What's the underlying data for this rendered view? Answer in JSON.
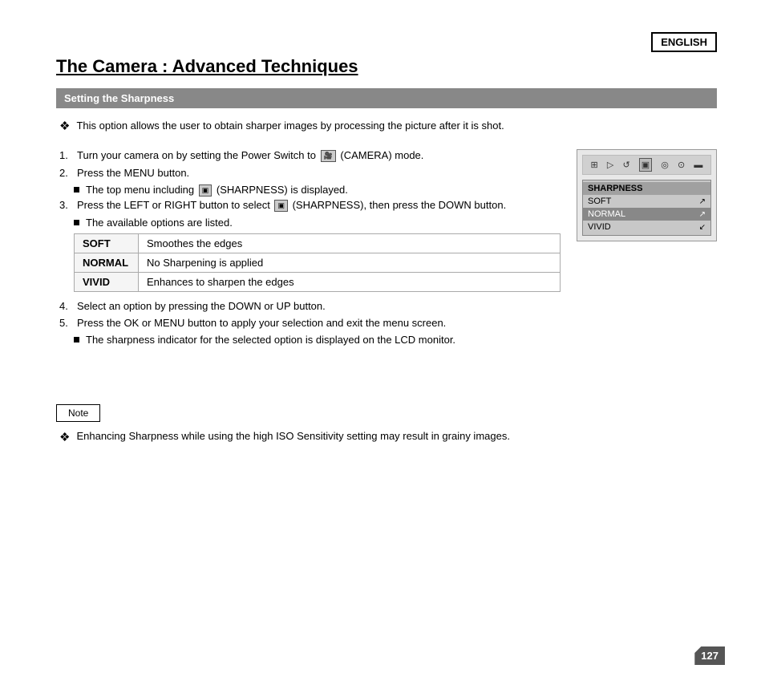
{
  "page": {
    "badge": "ENGLISH",
    "title": "The Camera : Advanced Techniques",
    "section_title": "Setting the Sharpness",
    "intro": "This option allows the user to obtain sharper images by processing the picture after it is shot.",
    "steps": [
      {
        "num": "1.",
        "text": "Turn your camera on by setting the Power Switch to  (CAMERA) mode."
      },
      {
        "num": "2.",
        "text": "Press the MENU button."
      },
      {
        "num": "2sub",
        "text": "The top menu including  (SHARPNESS) is displayed."
      },
      {
        "num": "3.",
        "text": "Press the LEFT or RIGHT button to select  (SHARPNESS), then press the DOWN button."
      },
      {
        "num": "3sub",
        "text": "The available options are listed."
      }
    ],
    "options_table": [
      {
        "key": "SOFT",
        "value": "Smoothes the edges"
      },
      {
        "key": "NORMAL",
        "value": "No Sharpening is applied"
      },
      {
        "key": "VIVID",
        "value": "Enhances to sharpen the edges"
      }
    ],
    "steps_after": [
      {
        "num": "4.",
        "text": "Select an option by pressing the DOWN or UP button."
      },
      {
        "num": "5.",
        "text": "Press the OK or MENU button to apply your selection and exit the menu screen."
      },
      {
        "num": "5sub",
        "text": "The sharpness indicator for the selected option is displayed on the LCD monitor."
      }
    ],
    "note_label": "Note",
    "note_text": "Enhancing Sharpness while using the high ISO Sensitivity setting may result in grainy images.",
    "page_number": "127",
    "camera_ui": {
      "menu_title": "SHARPNESS",
      "menu_items": [
        {
          "label": "SOFT",
          "icon": "↗",
          "highlighted": false
        },
        {
          "label": "NORMAL",
          "icon": "↗",
          "highlighted": true
        },
        {
          "label": "VIVID",
          "icon": "↙",
          "highlighted": false
        }
      ]
    }
  }
}
